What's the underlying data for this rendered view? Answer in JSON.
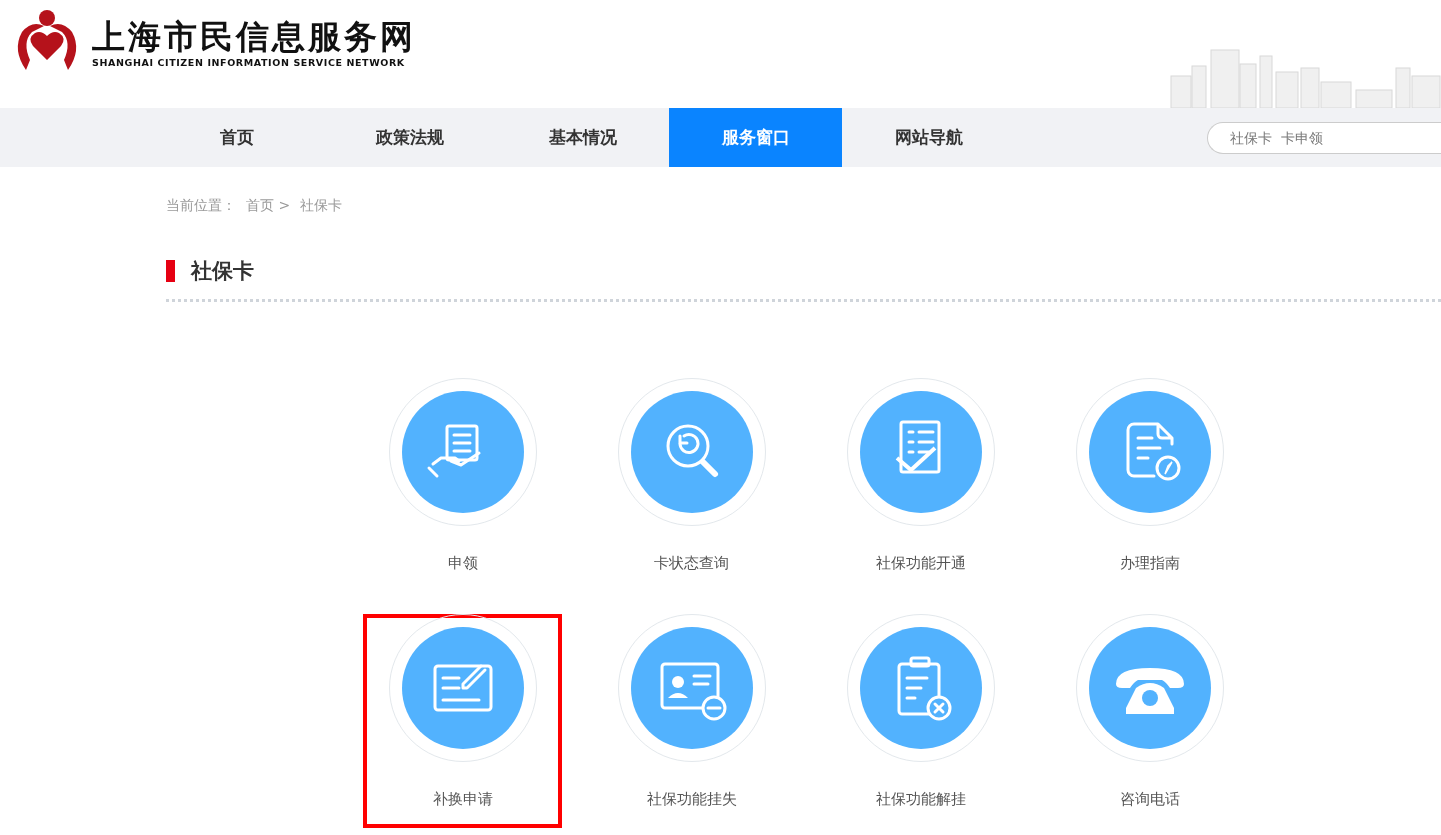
{
  "logo": {
    "title": "上海市民信息服务网",
    "subtitle": "SHANGHAI CITIZEN INFORMATION SERVICE NETWORK"
  },
  "nav": [
    {
      "label": "首页",
      "selected": false
    },
    {
      "label": "政策法规",
      "selected": false
    },
    {
      "label": "基本情况",
      "selected": false
    },
    {
      "label": "服务窗口",
      "selected": true
    },
    {
      "label": "网站导航",
      "selected": false
    }
  ],
  "search": {
    "placeholder": "社保卡  卡申领"
  },
  "breadcrumb": {
    "label": "当前位置：",
    "items": [
      "首页 >",
      "社保卡"
    ]
  },
  "section_title": "社保卡",
  "services": [
    {
      "label": "申领",
      "highlighted": false
    },
    {
      "label": "卡状态查询",
      "highlighted": false
    },
    {
      "label": "社保功能开通",
      "highlighted": false
    },
    {
      "label": "办理指南",
      "highlighted": false
    },
    {
      "label": "补换申请",
      "highlighted": true
    },
    {
      "label": "社保功能挂失",
      "highlighted": false
    },
    {
      "label": "社保功能解挂",
      "highlighted": false
    },
    {
      "label": "咨询电话",
      "highlighted": false
    }
  ]
}
